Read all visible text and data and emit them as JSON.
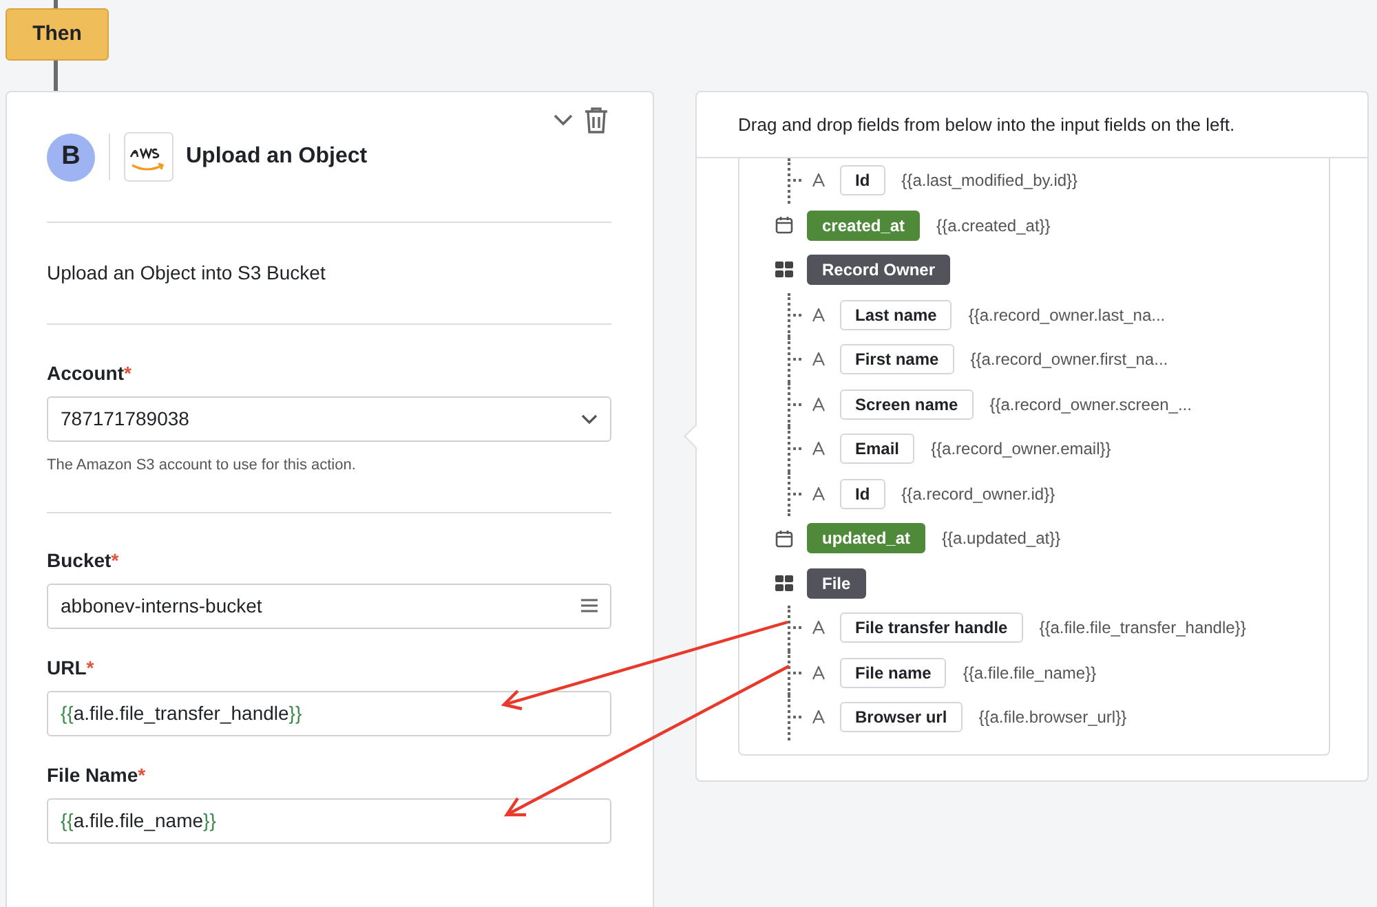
{
  "step_badge": "Then",
  "action_card": {
    "avatar": "B",
    "title": "Upload an Object",
    "description": "Upload an Object into S3 Bucket",
    "fields": [
      {
        "kind": "select",
        "label": "Account",
        "required_mark": "*",
        "value": "787171789038",
        "help": "The Amazon S3 account to use for this action."
      },
      {
        "kind": "list",
        "label": "Bucket",
        "required_mark": "*",
        "value": "abbonev-interns-bucket"
      },
      {
        "kind": "token",
        "label": "URL",
        "required_mark": "*",
        "open": "{{",
        "expression": "a.file.file_transfer_handle",
        "close": "}}"
      },
      {
        "kind": "token",
        "label": "File Name",
        "required_mark": "*",
        "open": "{{",
        "expression": "a.file.file_name",
        "close": "}}"
      }
    ]
  },
  "fields_panel": {
    "instruction": "Drag and drop fields from below into the input fields on the left.",
    "tree": [
      {
        "kind": "text",
        "label": "Id",
        "path": "{{a.last_modified_by.id}}"
      },
      {
        "kind": "date",
        "label": "created_at",
        "path": "{{a.created_at}}"
      },
      {
        "kind": "object",
        "label": "Record Owner",
        "children": [
          {
            "kind": "text",
            "label": "Last name",
            "path": "{{a.record_owner.last_na..."
          },
          {
            "kind": "text",
            "label": "First name",
            "path": "{{a.record_owner.first_na..."
          },
          {
            "kind": "text",
            "label": "Screen name",
            "path": "{{a.record_owner.screen_..."
          },
          {
            "kind": "text",
            "label": "Email",
            "path": "{{a.record_owner.email}}"
          },
          {
            "kind": "text",
            "label": "Id",
            "path": "{{a.record_owner.id}}"
          }
        ]
      },
      {
        "kind": "date",
        "label": "updated_at",
        "path": "{{a.updated_at}}"
      },
      {
        "kind": "object",
        "label": "File",
        "children": [
          {
            "kind": "text",
            "label": "File transfer handle",
            "path": "{{a.file.file_transfer_handle}}"
          },
          {
            "kind": "text",
            "label": "File name",
            "path": "{{a.file.file_name}}"
          },
          {
            "kind": "text",
            "label": "Browser url",
            "path": "{{a.file.browser_url}}"
          }
        ]
      }
    ]
  }
}
